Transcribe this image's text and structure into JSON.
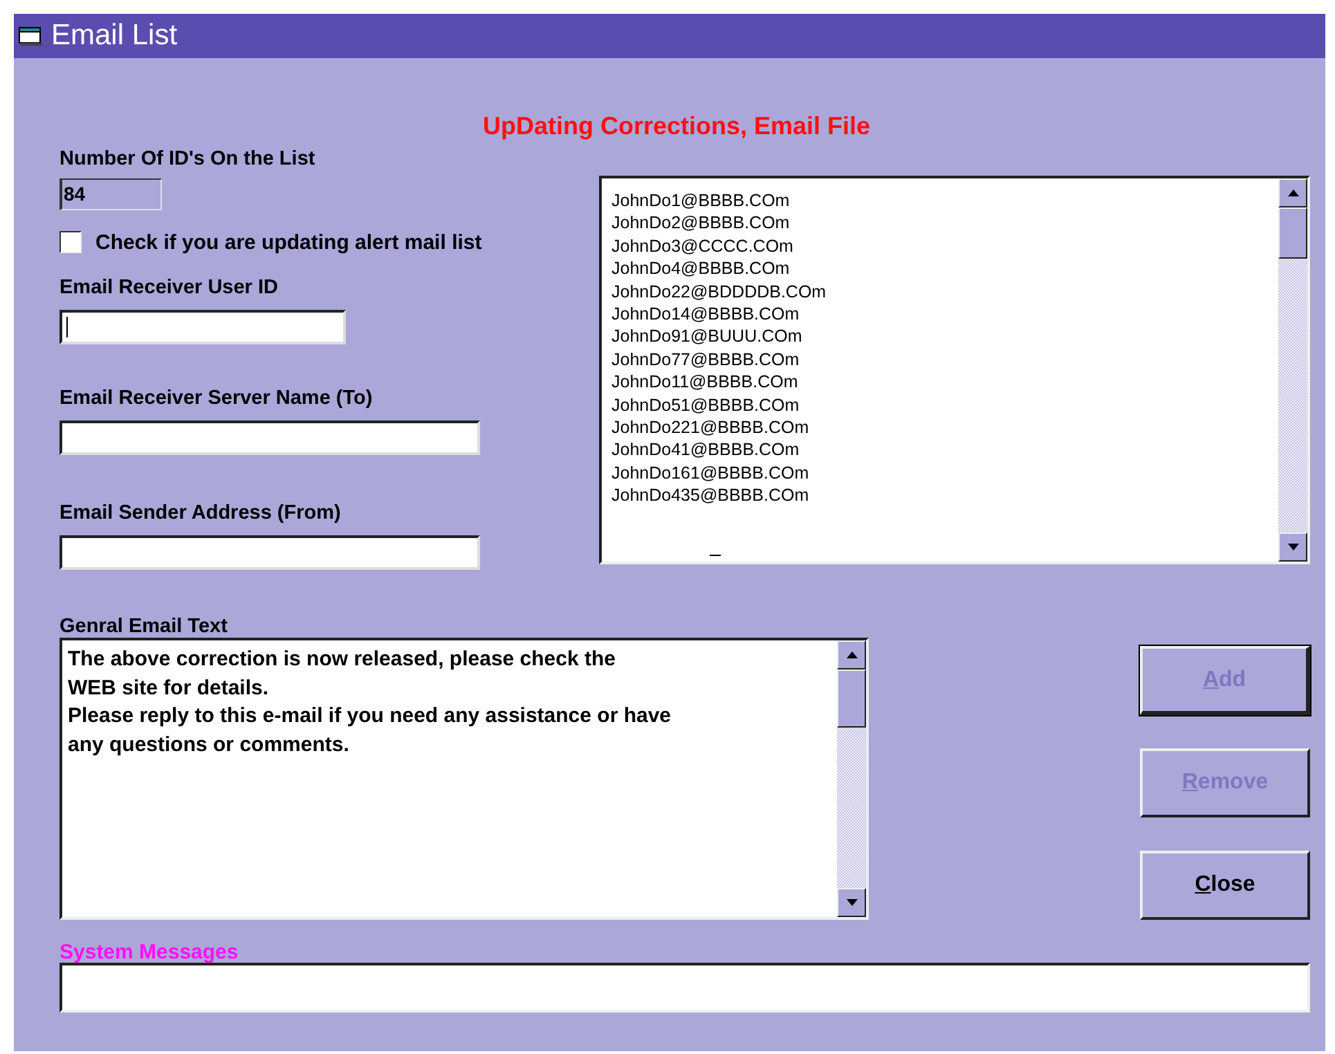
{
  "window": {
    "title": "Email List"
  },
  "heading": "UpDating  Corrections, Email File",
  "id_count": {
    "label": "Number Of ID's On the List",
    "value": "84"
  },
  "alert_checkbox": {
    "label": "Check if you are updating alert mail list",
    "checked": false
  },
  "fields": [
    {
      "label": "Email Receiver User ID",
      "focused": true
    },
    {
      "label": "Email Receiver Server Name (To)",
      "focused": false
    },
    {
      "label": "Email Sender Address (From)",
      "focused": false
    }
  ],
  "email_list": [
    "JohnDo1@BBBB.COm",
    "JohnDo2@BBBB.COm",
    "JohnDo3@CCCC.COm",
    "JohnDo4@BBBB.COm",
    "JohnDo22@BDDDDB.COm",
    "JohnDo14@BBBB.COm",
    "JohnDo91@BUUU.COm",
    "JohnDo77@BBBB.COm",
    "JohnDo11@BBBB.COm",
    "JohnDo51@BBBB.COm",
    "JohnDo221@BBBB.COm",
    "JohnDo41@BBBB.COm",
    "JohnDo161@BBBB.COm",
    "JohnDo435@BBBB.COm"
  ],
  "email_text": {
    "label": "Genral Email Text",
    "lines": [
      "The above correction is now released, please check the",
      "WEB site for details.",
      "Please reply to this e-mail if you need any assistance or have",
      "any questions or comments."
    ]
  },
  "buttons": [
    {
      "key": "A",
      "rest": "dd",
      "disabled": true,
      "default": true
    },
    {
      "key": "R",
      "rest": "emove",
      "disabled": true,
      "default": false
    },
    {
      "key": "C",
      "rest": "lose",
      "disabled": false,
      "default": false
    }
  ],
  "system_messages": {
    "label": "System Messages"
  }
}
